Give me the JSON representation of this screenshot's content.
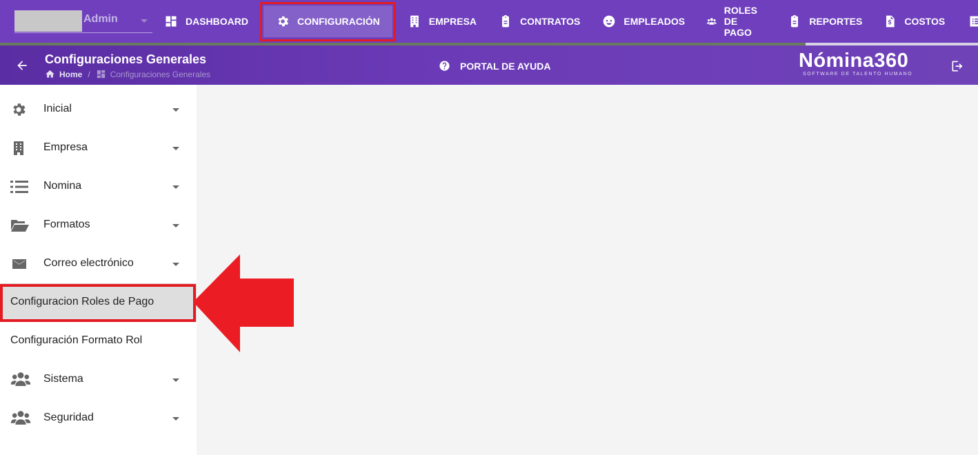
{
  "user": {
    "name": "Admin"
  },
  "nav": {
    "items": [
      {
        "label": "DASHBOARD",
        "icon": "dashboard-icon"
      },
      {
        "label": "CONFIGURACIÓN",
        "icon": "gear-icon",
        "active": true
      },
      {
        "label": "EMPRESA",
        "icon": "building-icon"
      },
      {
        "label": "CONTRATOS",
        "icon": "clipboard-icon"
      },
      {
        "label": "EMPLEADOS",
        "icon": "face-icon"
      },
      {
        "label": "ROLES DE PAGO",
        "icon": "users-icon"
      },
      {
        "label": "REPORTES",
        "icon": "clipboard-icon"
      },
      {
        "label": "COSTOS",
        "icon": "invoice-icon"
      }
    ]
  },
  "header": {
    "title": "Configuraciones Generales",
    "breadcrumb": {
      "home": "Home",
      "separator": "/",
      "current": "Configuraciones Generales"
    },
    "help": "PORTAL DE AYUDA",
    "logo": {
      "main": "Nómina360",
      "sub": "SOFTWARE DE TALENTO HUMANO"
    }
  },
  "sidebar": {
    "items": [
      {
        "label": "Inicial",
        "icon": "gear-icon",
        "expandable": true
      },
      {
        "label": "Empresa",
        "icon": "building-icon",
        "expandable": true
      },
      {
        "label": "Nomina",
        "icon": "list-icon",
        "expandable": true
      },
      {
        "label": "Formatos",
        "icon": "folder-open-icon",
        "expandable": true
      },
      {
        "label": "Correo electrónico",
        "icon": "mail-icon",
        "expandable": true
      },
      {
        "label": "Configuracion Roles de Pago",
        "selected": true
      },
      {
        "label": "Configuración Formato Rol"
      },
      {
        "label": "Sistema",
        "icon": "users-icon",
        "expandable": true
      },
      {
        "label": "Seguridad",
        "icon": "users-icon",
        "expandable": true
      }
    ]
  },
  "colors": {
    "primary": "#6f3fbd",
    "highlight": "#e31b23",
    "selected_bg": "#dedede"
  }
}
